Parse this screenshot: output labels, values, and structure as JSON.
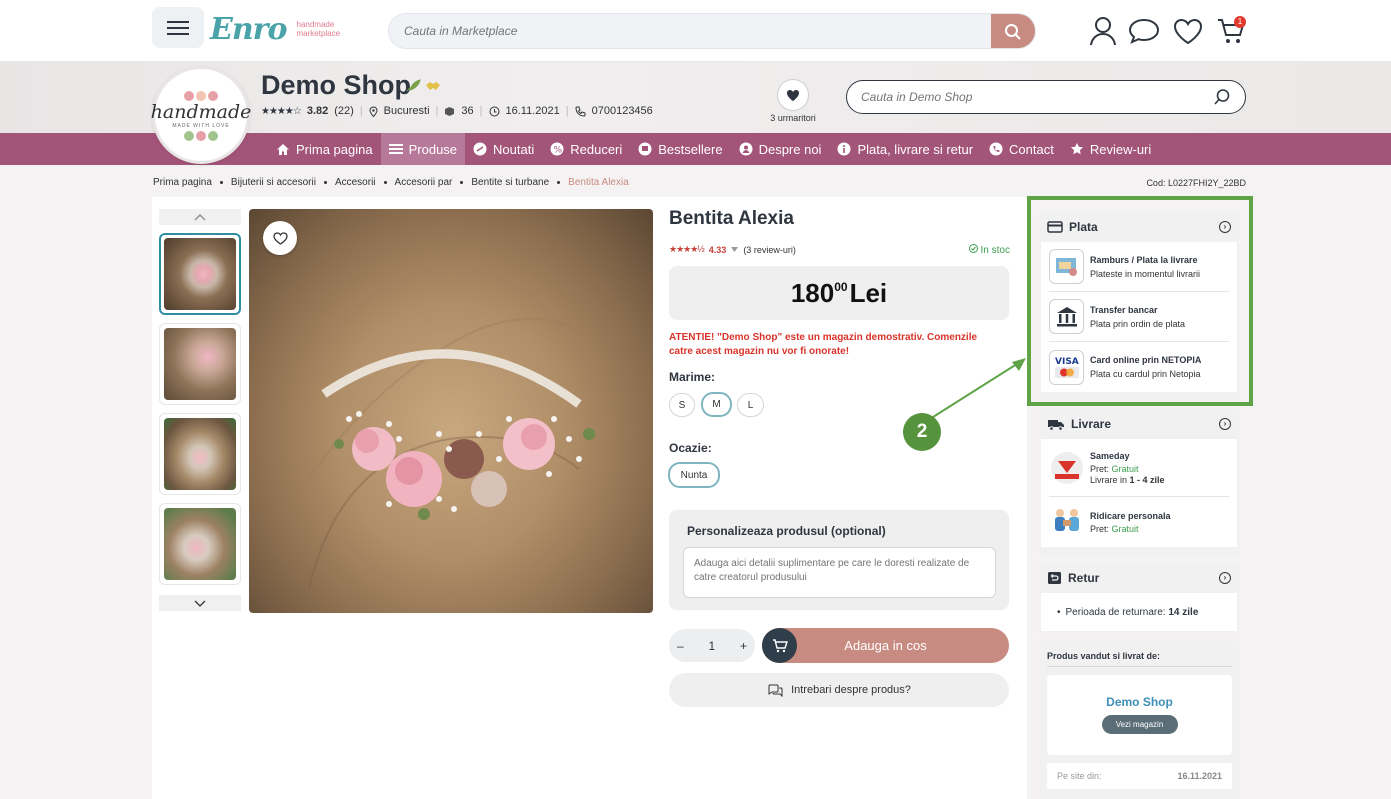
{
  "header": {
    "logo_word": "Enro",
    "logo_tagline_1": "handmade",
    "logo_tagline_2": "marketplace",
    "search_placeholder": "Cauta in Marketplace",
    "cart_count": "1"
  },
  "shop": {
    "logo_text": "handmade",
    "logo_subtext": "MADE WITH LOVE",
    "name": "Demo Shop",
    "rating": "3.82",
    "rating_count": "(22)",
    "location": "Bucuresti",
    "products": "36",
    "since": "16.11.2021",
    "phone": "0700123456",
    "followers": "3 urmaritori",
    "search_placeholder": "Cauta in Demo Shop"
  },
  "nav": {
    "items": [
      "Prima pagina",
      "Produse",
      "Noutati",
      "Reduceri",
      "Bestsellere",
      "Despre noi",
      "Plata, livrare si retur",
      "Contact",
      "Review-uri"
    ]
  },
  "breadcrumb": {
    "items": [
      "Prima pagina",
      "Bijuterii si accesorii",
      "Accesorii",
      "Accesorii par",
      "Bentite si turbane"
    ],
    "current": "Bentita Alexia"
  },
  "product": {
    "code": "Cod: L0227FHI2Y_22BD",
    "title": "Bentita Alexia",
    "rating": "4.33",
    "review_count": "(3 review-uri)",
    "stock": "In stoc",
    "price_int": "180",
    "price_dec": "00",
    "currency": "Lei",
    "warning": "ATENTIE! \"Demo Shop\" este un magazin demostrativ. Comenzile catre acest magazin nu vor fi onorate!",
    "size_label": "Marime:",
    "sizes": [
      "S",
      "M",
      "L"
    ],
    "selected_size": "M",
    "occasion_label": "Ocazie:",
    "occasion": "Nunta",
    "personalize_title": "Personalizeaza produsul (optional)",
    "personalize_placeholder": "Adauga aici detalii suplimentare pe care le doresti realizate de catre creatorul produsului",
    "quantity": "1",
    "qty_minus": "–",
    "qty_plus": "+",
    "add_to_cart": "Adauga in cos",
    "ask_question": "Intrebari despre produs?"
  },
  "sidebar": {
    "payment": {
      "title": "Plata",
      "options": [
        {
          "title": "Ramburs / Plata la livrare",
          "subtitle": "Plateste in momentul livrarii"
        },
        {
          "title": "Transfer bancar",
          "subtitle": "Plata prin ordin de plata"
        },
        {
          "title": "Card online prin NETOPIA",
          "subtitle": "Plata cu cardul prin Netopia"
        }
      ]
    },
    "delivery": {
      "title": "Livrare",
      "options": [
        {
          "title": "Sameday",
          "price_label": "Pret:",
          "price": "Gratuit",
          "eta_prefix": "Livrare in",
          "eta": "1 - 4 zile"
        },
        {
          "title": "Ridicare personala",
          "price_label": "Pret:",
          "price": "Gratuit"
        }
      ]
    },
    "returns": {
      "title": "Retur",
      "period_label": "Perioada de returnare:",
      "period": "14 zile"
    },
    "seller": {
      "title": "Produs vandut si livrat de:",
      "name": "Demo Shop",
      "visit": "Vezi magazin",
      "since_label": "Pe site din:",
      "since": "16.11.2021"
    }
  },
  "annotation": {
    "step": "2"
  },
  "colors": {
    "accent": "#c88b81",
    "nav_bg": "#a35479",
    "highlight": "#5fa346",
    "price_warning": "#d9342b",
    "stock_green": "#3d9d4e"
  }
}
